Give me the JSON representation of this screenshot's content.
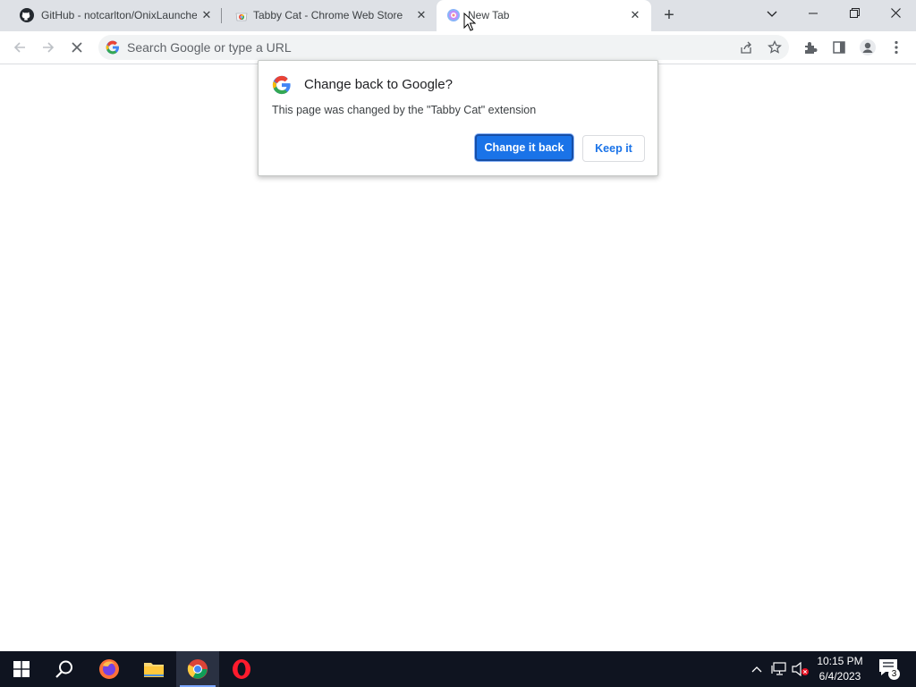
{
  "tabs": [
    {
      "title": "GitHub - notcarlton/OnixLauncher",
      "favicon": "github-icon"
    },
    {
      "title": "Tabby Cat - Chrome Web Store",
      "favicon": "webstore-icon"
    },
    {
      "title": "New Tab",
      "favicon": "tabbycat-icon"
    }
  ],
  "omnibox": {
    "placeholder": "Search Google or type a URL"
  },
  "popup": {
    "title": "Change back to Google?",
    "body": "This page was changed by the \"Tabby Cat\" extension",
    "primary_label": "Change it back",
    "secondary_label": "Keep it"
  },
  "clock": {
    "time": "10:15 PM",
    "date": "6/4/2023"
  },
  "notifications": {
    "count": "3"
  },
  "colors": {
    "accent": "#1a73e8",
    "taskbar": "#0f1420",
    "tabstrip": "#dee1e6"
  }
}
